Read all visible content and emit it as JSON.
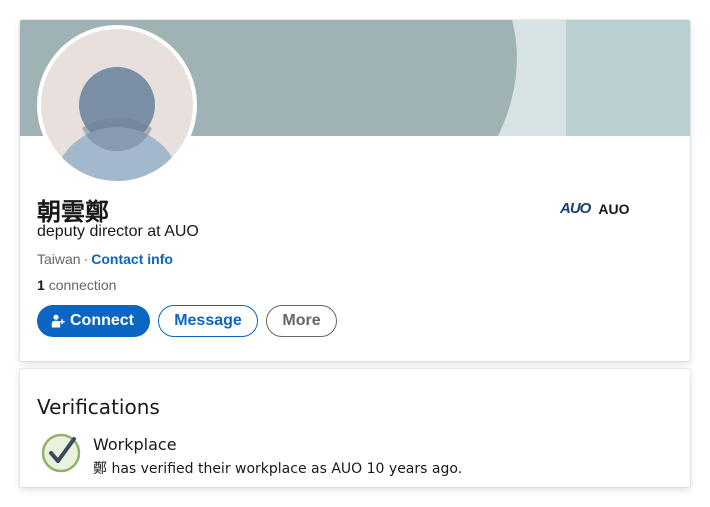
{
  "profile": {
    "name": "朝雲鄭",
    "headline": "deputy director at AUO",
    "location": "Taiwan",
    "separator": "·",
    "contact_label": "Contact info",
    "connections_count": "1",
    "connections_label": "connection",
    "company": {
      "logo_text": "AUO",
      "name": "AUO",
      "logo_color": "#1d3e70"
    }
  },
  "actions": {
    "connect_label": "Connect",
    "message_label": "Message",
    "more_label": "More"
  },
  "verifications": {
    "title": "Verifications",
    "item": {
      "heading": "Workplace",
      "description": "鄭 has verified their workplace as AUO 10 years ago.",
      "icon": "check-shield-icon"
    }
  },
  "colors": {
    "accent": "#0a66c2",
    "cover_main": "#9fb2b4",
    "cover_light": "#d6e2e3",
    "cover_right": "#b9cfd1",
    "avatar_bg": "#e7e0dc",
    "avatar_head": "#7a8ea6",
    "avatar_body": "#a4b8cc"
  }
}
